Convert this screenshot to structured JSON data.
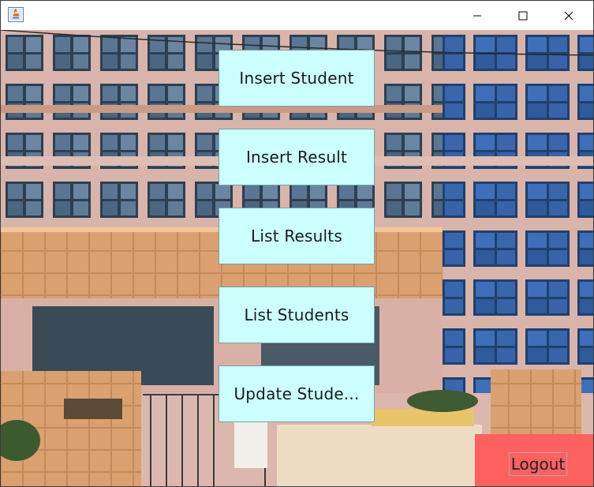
{
  "window": {
    "title": "",
    "controls": [
      "minimize-icon",
      "maximize-icon",
      "close-icon"
    ]
  },
  "background": {
    "subject": "school-building-image"
  },
  "menu": {
    "insert_student": "Insert Student",
    "insert_result": "Insert Result",
    "list_results": "List Results",
    "list_students": "List Students",
    "update_student": "Update Stude..."
  },
  "logout": {
    "label": "Logout"
  },
  "colors": {
    "button_bg": "#ccffff",
    "logout_bg": "#ff6060"
  }
}
